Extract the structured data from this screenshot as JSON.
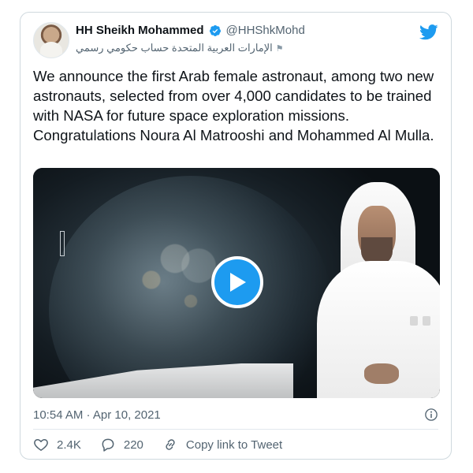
{
  "tweet": {
    "author": {
      "name": "HH Sheikh Mohammed",
      "handle": "@HHShkMohd",
      "label": "الإمارات العربية المتحدة حساب حكومي رسمي"
    },
    "text": "We announce the first Arab female astronaut, among two new astronauts, selected from over 4,000 candidates to be trained with NASA for future space exploration missions. Congratulations Noura Al Matrooshi and Mohammed Al Mulla.",
    "timestamp": "10:54 AM · Apr 10, 2021",
    "actions": {
      "likes": "2.4K",
      "replies": "220",
      "copy_link": "Copy link to Tweet"
    }
  },
  "icons": {
    "brand": "twitter-bird-icon",
    "verified": "verified-badge-icon",
    "play": "play-icon",
    "info": "info-icon",
    "heart": "heart-icon",
    "reply": "reply-icon",
    "link": "link-icon"
  },
  "colors": {
    "accent": "#1d9bf0",
    "text": "#0f1419",
    "muted": "#536471",
    "border": "#cfd9de"
  }
}
